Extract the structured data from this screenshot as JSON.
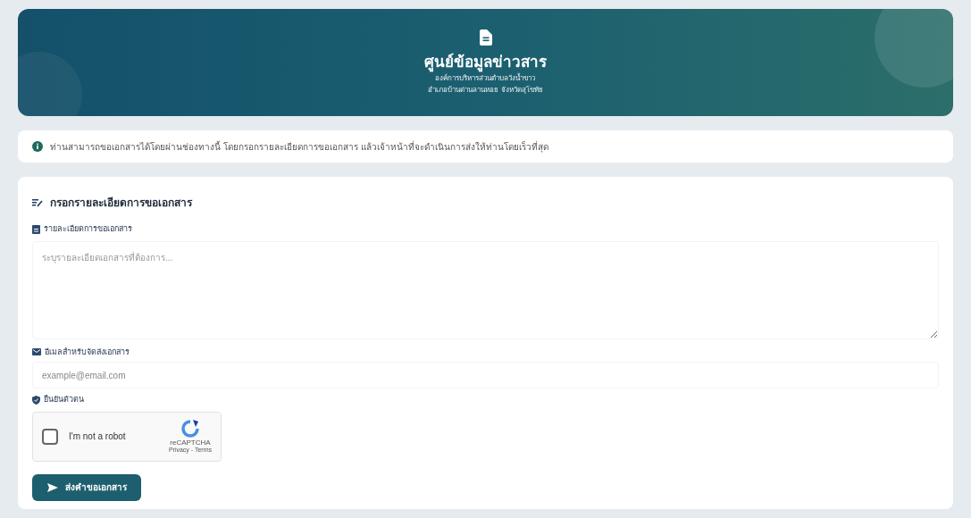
{
  "header": {
    "title": "ศูนย์ข้อมูลข่าวสาร",
    "subtitle_lines": [
      "องค์การบริหารส่วนตำบลวังน้ำขาว",
      "อำเภอบ้านด่านลานหอย จังหวัดสุโขทัย"
    ]
  },
  "notice": {
    "text": "ท่านสามารถขอเอกสารได้โดยผ่านช่องทางนี้ โดยกรอกรายละเอียดการขอเอกสาร แล้วเจ้าหน้าที่จะดำเนินการส่งให้ท่านโดยเร็วที่สุด"
  },
  "form": {
    "heading": "กรอกรายละเอียดการขอเอกสาร",
    "details": {
      "label": "รายละเอียดการขอเอกสาร",
      "placeholder": "ระบุรายละเอียดเอกสารที่ต้องการ..."
    },
    "email": {
      "label": "อีเมลสำหรับจัดส่งเอกสาร",
      "placeholder": "example@email.com"
    },
    "verification": {
      "label": "ยืนยันตัวตน",
      "captcha": {
        "label": "I'm not a robot",
        "checked": false,
        "brand": "reCAPTCHA",
        "links": "Privacy - Terms"
      }
    },
    "submit": "ส่งคำขอเอกสาร"
  }
}
